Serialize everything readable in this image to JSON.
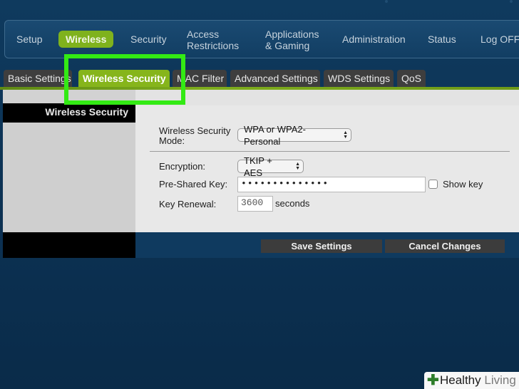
{
  "nav": {
    "items": [
      {
        "label": "Setup"
      },
      {
        "label": "Wireless"
      },
      {
        "label": "Security"
      },
      {
        "label": "Access\nRestrictions"
      },
      {
        "label": "Applications\n& Gaming"
      },
      {
        "label": "Administration"
      },
      {
        "label": "Status"
      },
      {
        "label": "Log OFF"
      }
    ],
    "active": "Wireless"
  },
  "tabs": [
    {
      "label": "Basic Settings"
    },
    {
      "label": "Wireless Security"
    },
    {
      "label": "MAC Filter"
    },
    {
      "label": "Advanced Settings"
    },
    {
      "label": "WDS Settings"
    },
    {
      "label": "QoS"
    }
  ],
  "active_tab": "Wireless Security",
  "sidebar": {
    "title": "Wireless Security"
  },
  "form": {
    "mode_label_1": "Wireless Security",
    "mode_label_2": "Mode:",
    "mode_value": "WPA or WPA2-Personal",
    "encryption_label": "Encryption:",
    "encryption_value": "TKIP + AES",
    "psk_label": "Pre-Shared Key:",
    "psk_value": "••••••••••••••",
    "show_key_label": "Show key",
    "renewal_label": "Key Renewal:",
    "renewal_value": "3600",
    "renewal_unit": "seconds"
  },
  "buttons": {
    "save": "Save Settings",
    "cancel": "Cancel Changes"
  },
  "watermark": {
    "brand_1": "Healthy",
    "brand_2": "Living"
  },
  "colors": {
    "accent_green": "#86b51b",
    "highlight_green": "#33ea14",
    "background_blue": "#0d3557"
  }
}
